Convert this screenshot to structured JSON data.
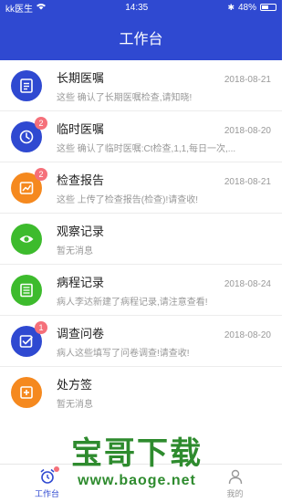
{
  "status": {
    "carrier": "kk医生",
    "time": "14:35",
    "battery": "48%"
  },
  "navbar": {
    "title": "工作台"
  },
  "items": [
    {
      "title": "长期医嘱",
      "date": "2018-08-21",
      "sub": "这些 确认了长期医嘱检查,请知晓!",
      "color": "#2f49d1",
      "icon": "document-icon",
      "badge": ""
    },
    {
      "title": "临时医嘱",
      "date": "2018-08-20",
      "sub": "这些 确认了临时医嘱:Ct检查,1,1,每日一次,...",
      "color": "#2f49d1",
      "icon": "clock-icon",
      "badge": "2"
    },
    {
      "title": "检查报告",
      "date": "2018-08-21",
      "sub": "这些 上传了检查报告(检查)!请查收!",
      "color": "#f5891f",
      "icon": "chart-icon",
      "badge": "2"
    },
    {
      "title": "观察记录",
      "date": "",
      "sub": "暂无消息",
      "color": "#3dbb2d",
      "icon": "eye-icon",
      "badge": ""
    },
    {
      "title": "病程记录",
      "date": "2018-08-24",
      "sub": "病人李达新建了病程记录,请注意查看!",
      "color": "#3dbb2d",
      "icon": "list-icon",
      "badge": ""
    },
    {
      "title": "调查问卷",
      "date": "2018-08-20",
      "sub": "病人这些填写了问卷调查!请查收!",
      "color": "#2f49d1",
      "icon": "checkbox-icon",
      "badge": "1"
    },
    {
      "title": "处方签",
      "date": "",
      "sub": "暂无消息",
      "color": "#f5891f",
      "icon": "prescription-icon",
      "badge": ""
    }
  ],
  "tabs": [
    {
      "label": "工作台",
      "icon": "alarm-clock-icon",
      "active": true
    },
    {
      "label": "",
      "icon": "",
      "active": false
    },
    {
      "label": "我的",
      "icon": "person-icon",
      "active": false
    }
  ],
  "watermark": {
    "main": "宝哥下载",
    "url": "www.baoge.net"
  }
}
